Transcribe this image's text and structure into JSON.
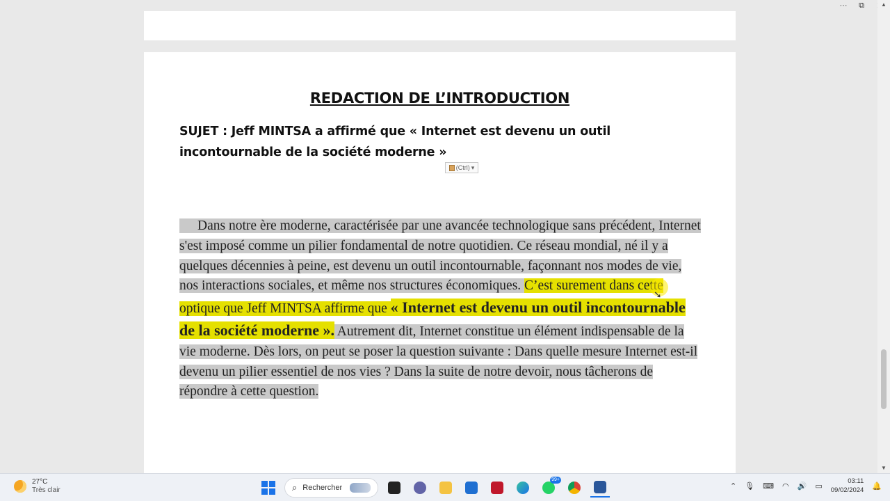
{
  "document": {
    "title": "REDACTION DE L’INTRODUCTION",
    "subject_line1": "SUJET : Jeff MINTSA a affirmé que « Internet est devenu un outil",
    "subject_line2": "incontournable de la société moderne »",
    "paste_options_label": "(Ctrl)",
    "paragraph": {
      "part1": "Dans notre ère moderne, caractérisée par une avancée technologique sans précédent, Internet s'est imposé comme un pilier fondamental de notre quotidien. Ce réseau mondial, né il y a quelques décennies à peine, est devenu un outil incontournable, façonnant nos modes de vie, nos interactions sociales, et même nos structures économiques. ",
      "highlight1": "C’est surement dans cette optique que Jeff MINTSA affirme que ",
      "highlight_quote": "« Internet est devenu un outil incontournable de la société moderne ».",
      "part2": " Autrement dit, Internet constitue un élément indispensable de la vie moderne. Dès lors, on peut se poser la question suivante : Dans quelle mesure Internet est-il devenu un pilier essentiel de nos vies ? Dans la suite de notre devoir, nous tâcherons de répondre à cette question."
    }
  },
  "window_controls": [
    "···",
    "⧉",
    "✕"
  ],
  "taskbar": {
    "weather_temp": "27°C",
    "weather_cond": "Très clair",
    "search_label": "Rechercher",
    "badge_count": "99+",
    "time": "03:11",
    "date": "09/02/2024"
  },
  "colors": {
    "highlight": "#e5e000",
    "selection": "#c9c9c9",
    "accent": "#1a73e8"
  }
}
